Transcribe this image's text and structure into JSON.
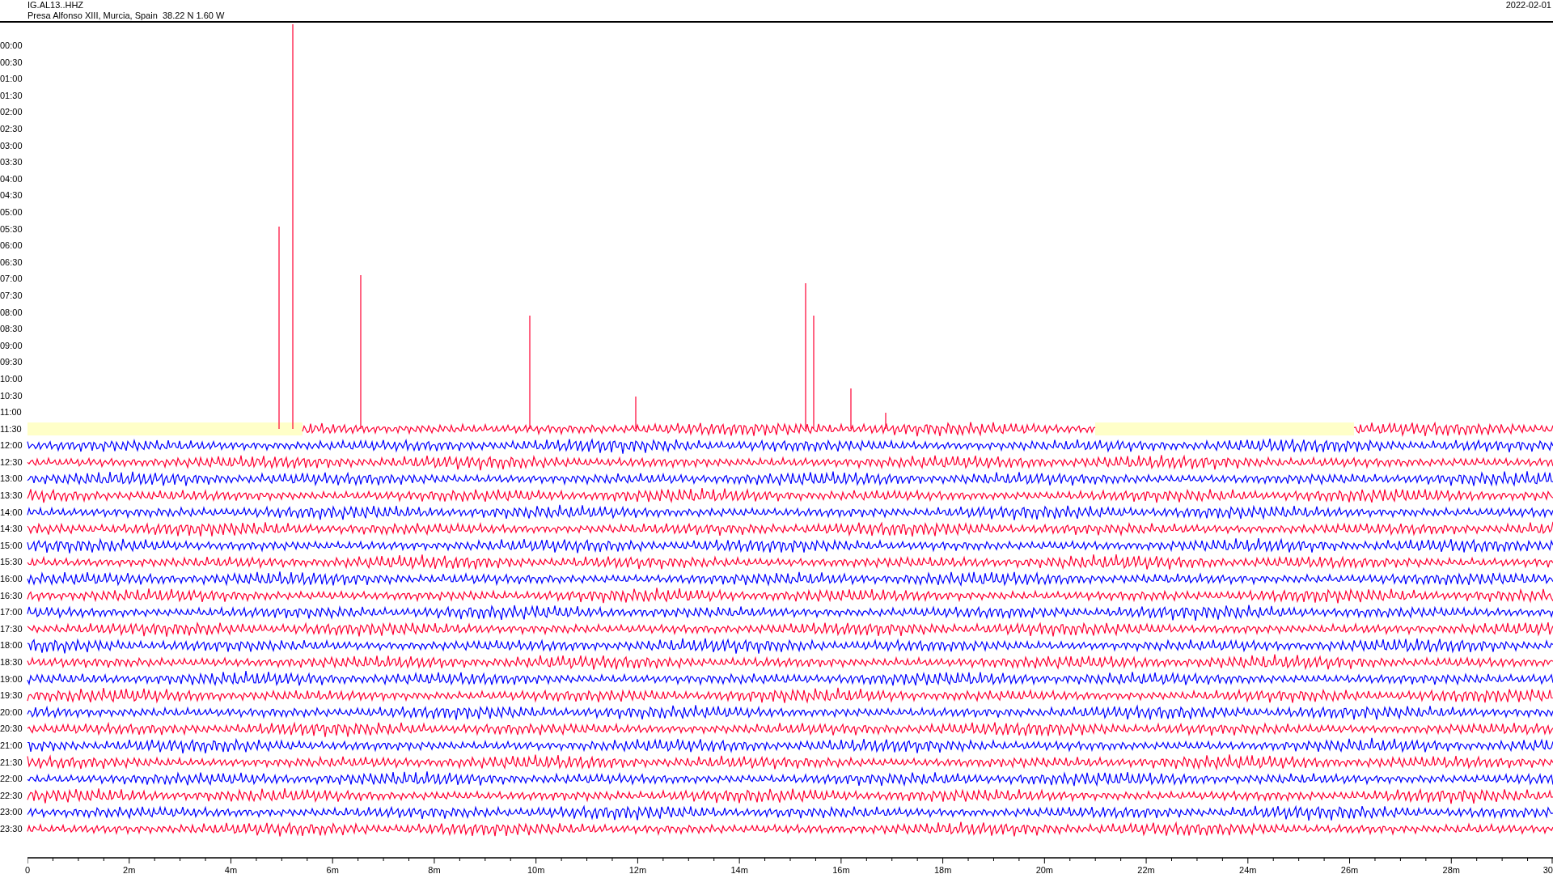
{
  "header": {
    "station": "IG.AL13..HHZ",
    "location": "Presa Alfonso XIII, Murcia, Spain  38.22 N 1.60 W",
    "date": "2022-02-01"
  },
  "rows": [
    {
      "label": "00:00",
      "kind": "empty"
    },
    {
      "label": "00:30",
      "kind": "empty"
    },
    {
      "label": "01:00",
      "kind": "empty"
    },
    {
      "label": "01:30",
      "kind": "empty"
    },
    {
      "label": "02:00",
      "kind": "empty"
    },
    {
      "label": "02:30",
      "kind": "empty"
    },
    {
      "label": "03:00",
      "kind": "empty"
    },
    {
      "label": "03:30",
      "kind": "empty"
    },
    {
      "label": "04:00",
      "kind": "empty"
    },
    {
      "label": "04:30",
      "kind": "empty"
    },
    {
      "label": "05:00",
      "kind": "empty"
    },
    {
      "label": "05:30",
      "kind": "empty"
    },
    {
      "label": "06:00",
      "kind": "empty"
    },
    {
      "label": "06:30",
      "kind": "empty"
    },
    {
      "label": "07:00",
      "kind": "empty"
    },
    {
      "label": "07:30",
      "kind": "empty"
    },
    {
      "label": "08:00",
      "kind": "empty"
    },
    {
      "label": "08:30",
      "kind": "empty"
    },
    {
      "label": "09:00",
      "kind": "empty"
    },
    {
      "label": "09:30",
      "kind": "empty"
    },
    {
      "label": "10:00",
      "kind": "empty"
    },
    {
      "label": "10:30",
      "kind": "empty"
    },
    {
      "label": "11:00",
      "kind": "empty"
    },
    {
      "label": "11:30",
      "kind": "partial",
      "color": "#ff0033"
    },
    {
      "label": "12:00",
      "kind": "full",
      "color": "#0000ff"
    },
    {
      "label": "12:30",
      "kind": "full",
      "color": "#ff0033"
    },
    {
      "label": "13:00",
      "kind": "full",
      "color": "#0000ff"
    },
    {
      "label": "13:30",
      "kind": "full",
      "color": "#ff0033"
    },
    {
      "label": "14:00",
      "kind": "full",
      "color": "#0000ff"
    },
    {
      "label": "14:30",
      "kind": "full",
      "color": "#ff0033"
    },
    {
      "label": "15:00",
      "kind": "full",
      "color": "#0000ff"
    },
    {
      "label": "15:30",
      "kind": "full",
      "color": "#ff0033"
    },
    {
      "label": "16:00",
      "kind": "full",
      "color": "#0000ff"
    },
    {
      "label": "16:30",
      "kind": "full",
      "color": "#ff0033"
    },
    {
      "label": "17:00",
      "kind": "full",
      "color": "#0000ff"
    },
    {
      "label": "17:30",
      "kind": "full",
      "color": "#ff0033"
    },
    {
      "label": "18:00",
      "kind": "full",
      "color": "#0000ff"
    },
    {
      "label": "18:30",
      "kind": "full",
      "color": "#ff0033"
    },
    {
      "label": "19:00",
      "kind": "full",
      "color": "#0000ff"
    },
    {
      "label": "19:30",
      "kind": "full",
      "color": "#ff0033"
    },
    {
      "label": "20:00",
      "kind": "full",
      "color": "#0000ff"
    },
    {
      "label": "20:30",
      "kind": "full",
      "color": "#ff0033"
    },
    {
      "label": "21:00",
      "kind": "full",
      "color": "#0000ff"
    },
    {
      "label": "21:30",
      "kind": "full",
      "color": "#ff0033"
    },
    {
      "label": "22:00",
      "kind": "full",
      "color": "#0000ff"
    },
    {
      "label": "22:30",
      "kind": "full",
      "color": "#ff0033"
    },
    {
      "label": "23:00",
      "kind": "full",
      "color": "#0000ff"
    },
    {
      "label": "23:30",
      "kind": "full",
      "color": "#ff0033"
    }
  ],
  "x_axis": {
    "ticks": [
      "0",
      "2m",
      "4m",
      "6m",
      "8m",
      "10m",
      "12m",
      "14m",
      "16m",
      "18m",
      "20m",
      "22m",
      "24m",
      "26m",
      "28m",
      "30"
    ]
  }
}
